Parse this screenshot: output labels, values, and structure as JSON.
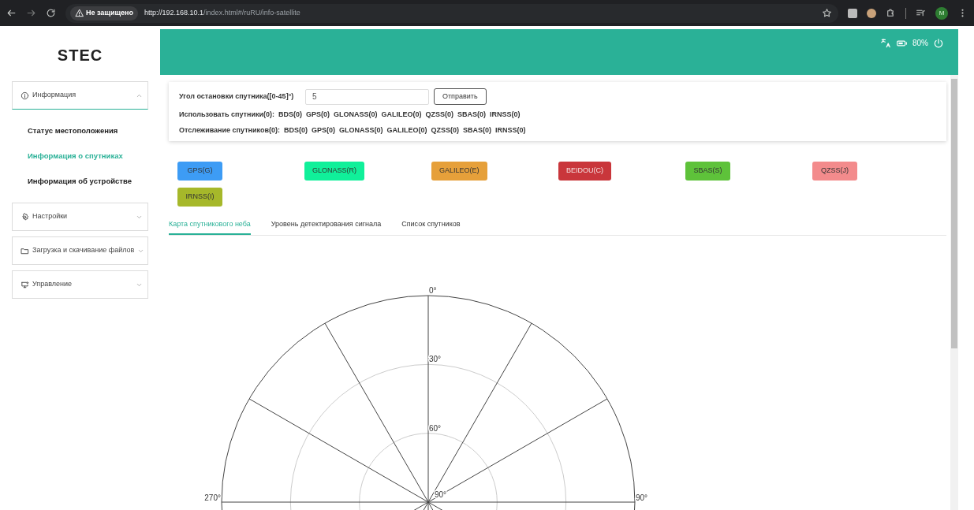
{
  "browser": {
    "security_label": "Не защищено",
    "url_host": "http://192.168.10.1",
    "url_path": "/index.html#/ruRU/info-satellite",
    "avatar_letter": "M"
  },
  "sidebar": {
    "logo": "STEC",
    "menus": [
      {
        "label": "Информация",
        "expanded": true,
        "children": [
          {
            "label": "Статус местоположения",
            "selected": false
          },
          {
            "label": "Информация о спутниках",
            "selected": true
          },
          {
            "label": "Информация об устройстве",
            "selected": false
          }
        ]
      },
      {
        "label": "Настройки",
        "expanded": false
      },
      {
        "label": "Загрузка и скачивание файлов",
        "expanded": false
      },
      {
        "label": "Управление",
        "expanded": false
      }
    ]
  },
  "header": {
    "battery": "80%"
  },
  "cutoff": {
    "label": "Угол остановки спутника([0-45]°)",
    "value": "5",
    "button": "Отправить"
  },
  "used": {
    "label": "Использовать спутники(0):",
    "systems": [
      "BDS(0)",
      "GPS(0)",
      "GLONASS(0)",
      "GALILEO(0)",
      "QZSS(0)",
      "SBAS(0)",
      "IRNSS(0)"
    ]
  },
  "tracked": {
    "label": "Отслеживание спутников(0):",
    "systems": [
      "BDS(0)",
      "GPS(0)",
      "GLONASS(0)",
      "GALILEO(0)",
      "QZSS(0)",
      "SBAS(0)",
      "IRNSS(0)"
    ]
  },
  "legend": [
    {
      "label": "GPS(G)",
      "color": "#3d9cf5"
    },
    {
      "label": "GLONASS(R)",
      "color": "#10f09a"
    },
    {
      "label": "GALILEO(E)",
      "color": "#e6a03a"
    },
    {
      "label": "BEIDOU(C)",
      "color": "#c9363b"
    },
    {
      "label": "SBAS(S)",
      "color": "#5ec23a"
    },
    {
      "label": "QZSS(J)",
      "color": "#f38b8c"
    },
    {
      "label": "IRNSS(I)",
      "color": "#a6b82a"
    }
  ],
  "tabs": [
    {
      "label": "Карта спутникового неба",
      "selected": true
    },
    {
      "label": "Уровень детектирования сигнала",
      "selected": false
    },
    {
      "label": "Список спутников",
      "selected": false
    }
  ],
  "sky_map": {
    "elevation_labels": [
      "0°",
      "30°",
      "60°",
      "90°"
    ],
    "azimuth_labels": [
      "270°",
      "90°"
    ]
  }
}
